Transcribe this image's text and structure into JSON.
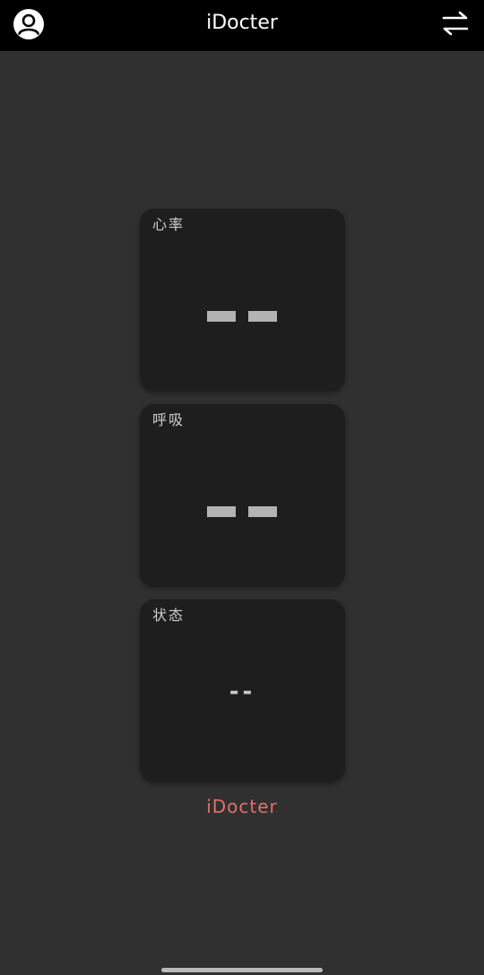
{
  "header": {
    "title": "iDocter",
    "left_icon": "profile-icon",
    "right_icon": "swap-arrows-icon"
  },
  "cards": [
    {
      "label": "心率",
      "value": "--"
    },
    {
      "label": "呼吸",
      "value": "--"
    },
    {
      "label": "状态",
      "value": "--"
    }
  ],
  "footer": {
    "brand": "iDocter"
  },
  "colors": {
    "background": "#303030",
    "topbar": "#000000",
    "card": "#1e1e1e",
    "brand_accent": "#e0706a"
  }
}
